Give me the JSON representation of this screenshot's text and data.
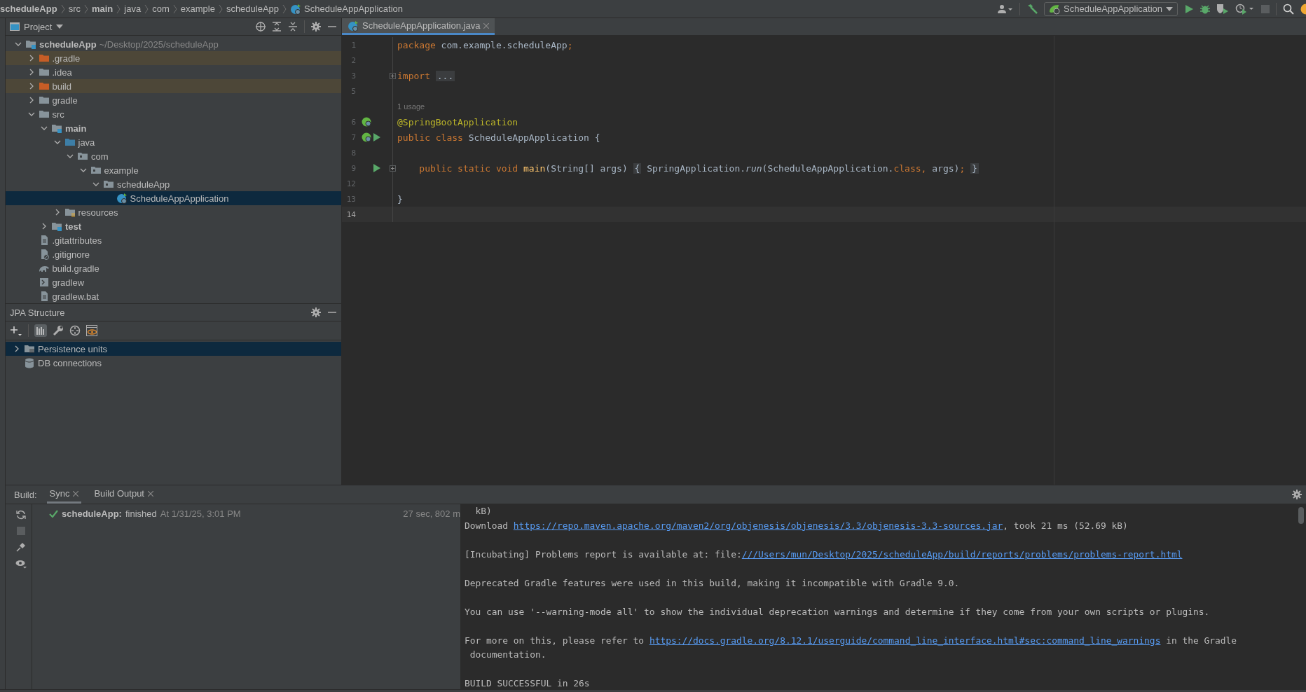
{
  "breadcrumbs": [
    {
      "text": "scheduleApp",
      "kind": "module"
    },
    {
      "text": "src",
      "kind": "folder"
    },
    {
      "text": "main",
      "kind": "module"
    },
    {
      "text": "java",
      "kind": "folder"
    },
    {
      "text": "com",
      "kind": "folder"
    },
    {
      "text": "example",
      "kind": "folder"
    },
    {
      "text": "scheduleApp",
      "kind": "folder"
    },
    {
      "text": "ScheduleAppApplication",
      "kind": "class"
    }
  ],
  "toolbar": {
    "run_config": "ScheduleAppApplication"
  },
  "project_panel": {
    "title": "Project",
    "tree": [
      {
        "text": "scheduleApp",
        "path": "~/Desktop/2025/scheduleApp",
        "kind": "module",
        "expanded": true,
        "children": [
          {
            "text": ".gradle",
            "kind": "folder",
            "excluded": true,
            "expanded": false,
            "selected": false
          },
          {
            "text": ".idea",
            "kind": "folder",
            "excluded": false,
            "expanded": false,
            "selected": false
          },
          {
            "text": "build",
            "kind": "folder",
            "excluded": true,
            "expanded": false,
            "selected": false
          },
          {
            "text": "gradle",
            "kind": "folder",
            "excluded": false,
            "expanded": false,
            "selected": false
          },
          {
            "text": "src",
            "kind": "folder",
            "excluded": false,
            "expanded": true,
            "selected": false,
            "children": [
              {
                "text": "main",
                "kind": "module",
                "excluded": false,
                "expanded": true,
                "selected": false,
                "children": [
                  {
                    "text": "java",
                    "kind": "source",
                    "excluded": false,
                    "expanded": true,
                    "selected": false,
                    "children": [
                      {
                        "text": "com",
                        "kind": "package",
                        "excluded": false,
                        "expanded": true,
                        "selected": false,
                        "children": [
                          {
                            "text": "example",
                            "kind": "package",
                            "excluded": false,
                            "expanded": true,
                            "selected": false,
                            "children": [
                              {
                                "text": "scheduleApp",
                                "kind": "package",
                                "excluded": false,
                                "expanded": true,
                                "selected": false,
                                "children": [
                                  {
                                    "text": "ScheduleAppApplication",
                                    "kind": "class",
                                    "excluded": false,
                                    "selected": true
                                  }
                                ]
                              }
                            ]
                          }
                        ]
                      }
                    ]
                  },
                  {
                    "text": "resources",
                    "kind": "resources",
                    "excluded": false,
                    "expanded": false,
                    "selected": false
                  }
                ]
              },
              {
                "text": "test",
                "kind": "module",
                "excluded": false,
                "expanded": false,
                "selected": false
              }
            ]
          },
          {
            "text": ".gitattributes",
            "kind": "file",
            "excluded": false,
            "selected": false
          },
          {
            "text": ".gitignore",
            "kind": "ignore",
            "excluded": false,
            "selected": false
          },
          {
            "text": "build.gradle",
            "kind": "gradle",
            "excluded": false,
            "selected": false
          },
          {
            "text": "gradlew",
            "kind": "script",
            "excluded": false,
            "selected": false
          },
          {
            "text": "gradlew.bat",
            "kind": "file",
            "excluded": false,
            "selected": false
          }
        ],
        "excluded": false,
        "selected": false
      }
    ]
  },
  "editor": {
    "tabs": [
      {
        "label": "ScheduleAppApplication.java",
        "selected": true
      }
    ],
    "lines": [
      {
        "number": "1",
        "tokens": [
          {
            "text": "package",
            "kind": "keyword"
          },
          {
            "text": " com.example.scheduleApp",
            "kind": "plain"
          },
          {
            "text": ";",
            "kind": "keyword"
          }
        ]
      },
      {
        "number": "2"
      },
      {
        "number": "3",
        "foldable": true,
        "tokens": [
          {
            "text": "import ",
            "kind": "keyword"
          },
          {
            "text": "...",
            "kind": "folded"
          }
        ]
      },
      {
        "number": "5"
      },
      {
        "hint": "1 usage"
      },
      {
        "number": "6",
        "spring_bean": true,
        "tokens": [
          {
            "text": "@SpringBootApplication",
            "kind": "annotation"
          }
        ]
      },
      {
        "number": "7",
        "spring_bean": true,
        "runnable": true,
        "tokens": [
          {
            "text": "public class",
            "kind": "keyword"
          },
          {
            "text": " ScheduleAppApplication {",
            "kind": "plain"
          }
        ]
      },
      {
        "number": "8"
      },
      {
        "number": "9",
        "runnable": true,
        "foldable": true,
        "tokens": [
          {
            "text": "    public static void ",
            "kind": "keyword"
          },
          {
            "text": "main",
            "kind": "method"
          },
          {
            "text": "(String[] args) ",
            "kind": "plain"
          },
          {
            "text": "{",
            "kind": "folded"
          },
          {
            "text": " SpringApplication.",
            "kind": "plain"
          },
          {
            "text": "run",
            "kind": "static"
          },
          {
            "text": "(ScheduleAppApplication.",
            "kind": "plain"
          },
          {
            "text": "class, ",
            "kind": "keyword"
          },
          {
            "text": "args)",
            "kind": "plain"
          },
          {
            "text": "; ",
            "kind": "keyword"
          },
          {
            "text": "}",
            "kind": "folded"
          }
        ]
      },
      {
        "number": "12"
      },
      {
        "number": "13",
        "tokens": [
          {
            "text": "}",
            "kind": "plain"
          }
        ]
      },
      {
        "number": "14",
        "current": true
      }
    ]
  },
  "jpa_panel": {
    "title": "JPA Structure",
    "tree": [
      {
        "text": "Persistence units",
        "kind": "units",
        "expanded": false,
        "selected": true
      },
      {
        "text": "DB connections",
        "kind": "db",
        "selected": false
      }
    ]
  },
  "build_panel": {
    "label": "Build:",
    "tabs": [
      {
        "label": "Sync",
        "selected": true
      },
      {
        "label": "Build Output",
        "selected": false
      }
    ],
    "sync": {
      "name": "scheduleApp:",
      "status": "finished",
      "time": "At 1/31/25, 3:01 PM",
      "duration": "27 sec, 802 m"
    },
    "output": [
      {
        "spaced": false,
        "segments": [
          {
            "text": "  kB)",
            "kind": "text"
          }
        ]
      },
      {
        "spaced": false,
        "segments": [
          {
            "text": "Download ",
            "kind": "text"
          },
          {
            "text": "https://repo.maven.apache.org/maven2/org/objenesis/objenesis/3.3/objenesis-3.3-sources.jar",
            "kind": "link"
          },
          {
            "text": ", took 21 ms (52.69 kB)",
            "kind": "text"
          }
        ]
      },
      {
        "spaced": true,
        "segments": [
          {
            "text": "[Incubating] Problems report is available at: file:",
            "kind": "text"
          },
          {
            "text": "///Users/mun/Desktop/2025/scheduleApp/build/reports/problems/problems-report.html",
            "kind": "link"
          }
        ]
      },
      {
        "spaced": true,
        "segments": [
          {
            "text": "Deprecated Gradle features were used in this build, making it incompatible with Gradle 9.0.",
            "kind": "text"
          }
        ]
      },
      {
        "spaced": true,
        "segments": [
          {
            "text": "You can use '--warning-mode all' to show the individual deprecation warnings and determine if they come from your own scripts or plugins.",
            "kind": "text"
          }
        ]
      },
      {
        "spaced": true,
        "segments": [
          {
            "text": "For more on this, please refer to ",
            "kind": "text"
          },
          {
            "text": "https://docs.gradle.org/8.12.1/userguide/command_line_interface.html#sec:command_line_warnings",
            "kind": "link"
          },
          {
            "text": " in the Gradle",
            "kind": "text"
          }
        ]
      },
      {
        "spaced": false,
        "segments": [
          {
            "text": " documentation.",
            "kind": "text"
          }
        ]
      },
      {
        "spaced": true,
        "segments": [
          {
            "text": "BUILD SUCCESSFUL in 26s",
            "kind": "text"
          }
        ]
      }
    ]
  }
}
